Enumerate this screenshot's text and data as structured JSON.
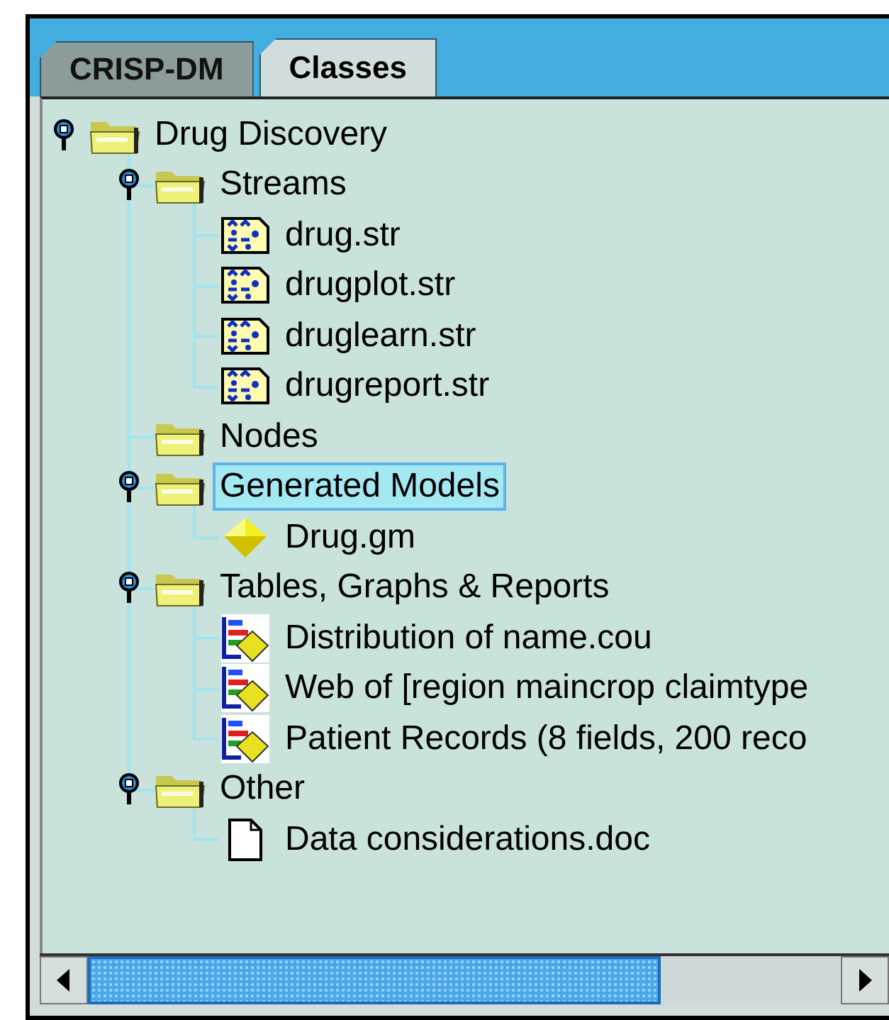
{
  "tabs": [
    {
      "label": "CRISP-DM",
      "selected": false
    },
    {
      "label": "Classes",
      "selected": true
    }
  ],
  "tree": [
    {
      "label": "Drug Discovery",
      "kind": "folder",
      "expanded": true,
      "selected": false,
      "children": [
        {
          "label": "Streams",
          "kind": "folder",
          "expanded": true,
          "selected": false,
          "children": [
            {
              "label": "drug.str",
              "kind": "stream",
              "selected": false
            },
            {
              "label": "drugplot.str",
              "kind": "stream",
              "selected": false
            },
            {
              "label": "druglearn.str",
              "kind": "stream",
              "selected": false
            },
            {
              "label": "drugreport.str",
              "kind": "stream",
              "selected": false
            }
          ]
        },
        {
          "label": "Nodes",
          "kind": "folder",
          "selected": false
        },
        {
          "label": "Generated Models",
          "kind": "folder",
          "expanded": true,
          "selected": true,
          "children": [
            {
              "label": "Drug.gm",
              "kind": "model",
              "selected": false
            }
          ]
        },
        {
          "label": "Tables, Graphs & Reports",
          "kind": "folder",
          "expanded": true,
          "selected": false,
          "children": [
            {
              "label": "Distribution of name.cou",
              "kind": "output",
              "selected": false
            },
            {
              "label": "Web of [region maincrop claimtype",
              "kind": "output",
              "selected": false
            },
            {
              "label": "Patient Records (8 fields, 200 reco",
              "kind": "output",
              "selected": false
            }
          ]
        },
        {
          "label": "Other",
          "kind": "folder",
          "expanded": true,
          "selected": false,
          "children": [
            {
              "label": "Data considerations.doc",
              "kind": "doc",
              "selected": false
            }
          ]
        }
      ]
    }
  ]
}
